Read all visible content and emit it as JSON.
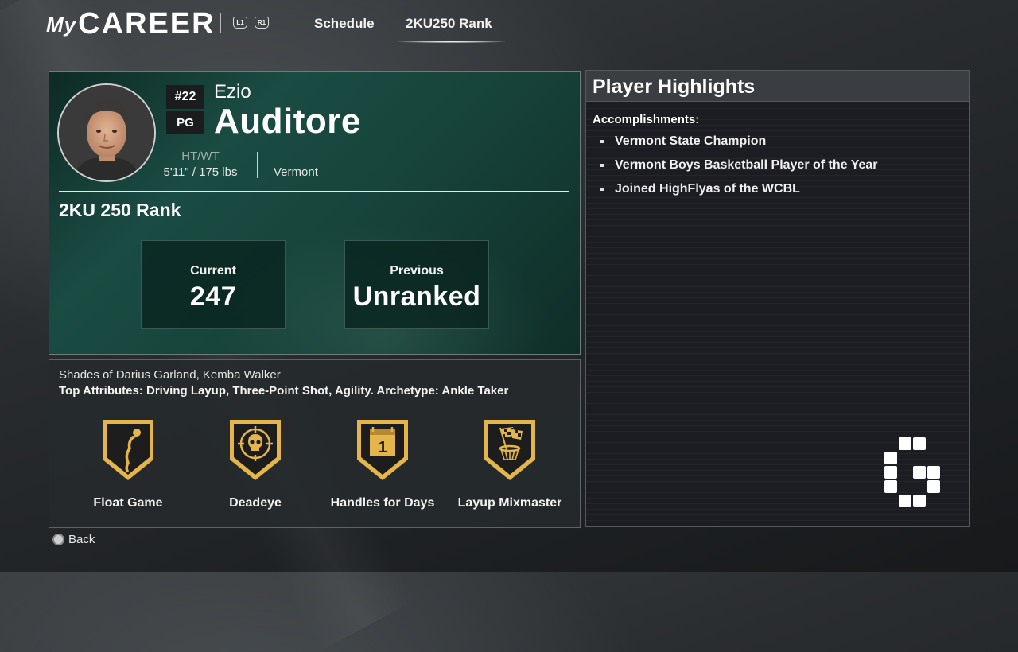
{
  "header": {
    "logo_my": "My",
    "logo_career": "CAREER",
    "bumper_left": "L1",
    "bumper_right": "R1",
    "tabs": [
      {
        "label": "Schedule",
        "active": false
      },
      {
        "label": "2KU250 Rank",
        "active": true
      }
    ]
  },
  "player": {
    "number": "#22",
    "position": "PG",
    "first_name": "Ezio",
    "last_name": "Auditore",
    "htwt_label": "HT/WT",
    "htwt_value": "5'11\" / 175 lbs",
    "hometown": "Vermont"
  },
  "rank": {
    "title": "2KU 250 Rank",
    "current_label": "Current",
    "current_value": "247",
    "previous_label": "Previous",
    "previous_value": "Unranked"
  },
  "profile": {
    "shades": "Shades of Darius Garland, Kemba Walker",
    "top_attributes": "Top Attributes: Driving Layup, Three-Point Shot, Agility. Archetype: Ankle Taker"
  },
  "badges": [
    {
      "name": "Float Game",
      "icon": "float-game-icon"
    },
    {
      "name": "Deadeye",
      "icon": "skull-crosshair-icon"
    },
    {
      "name": "Handles for Days",
      "icon": "calendar-icon"
    },
    {
      "name": "Layup Mixmaster",
      "icon": "checkered-flag-hoop-icon"
    }
  ],
  "highlights": {
    "title": "Player Highlights",
    "accomplishments_label": "Accomplishments:",
    "items": [
      "Vermont State Champion",
      "Vermont Boys Basketball Player of the Year",
      "Joined HighFlyas of the WCBL"
    ]
  },
  "footer": {
    "back_label": "Back"
  },
  "colors": {
    "card_green": "#1a4c43",
    "badge_gold": "#e3b54a",
    "badge_dark": "#1d1d1d"
  }
}
